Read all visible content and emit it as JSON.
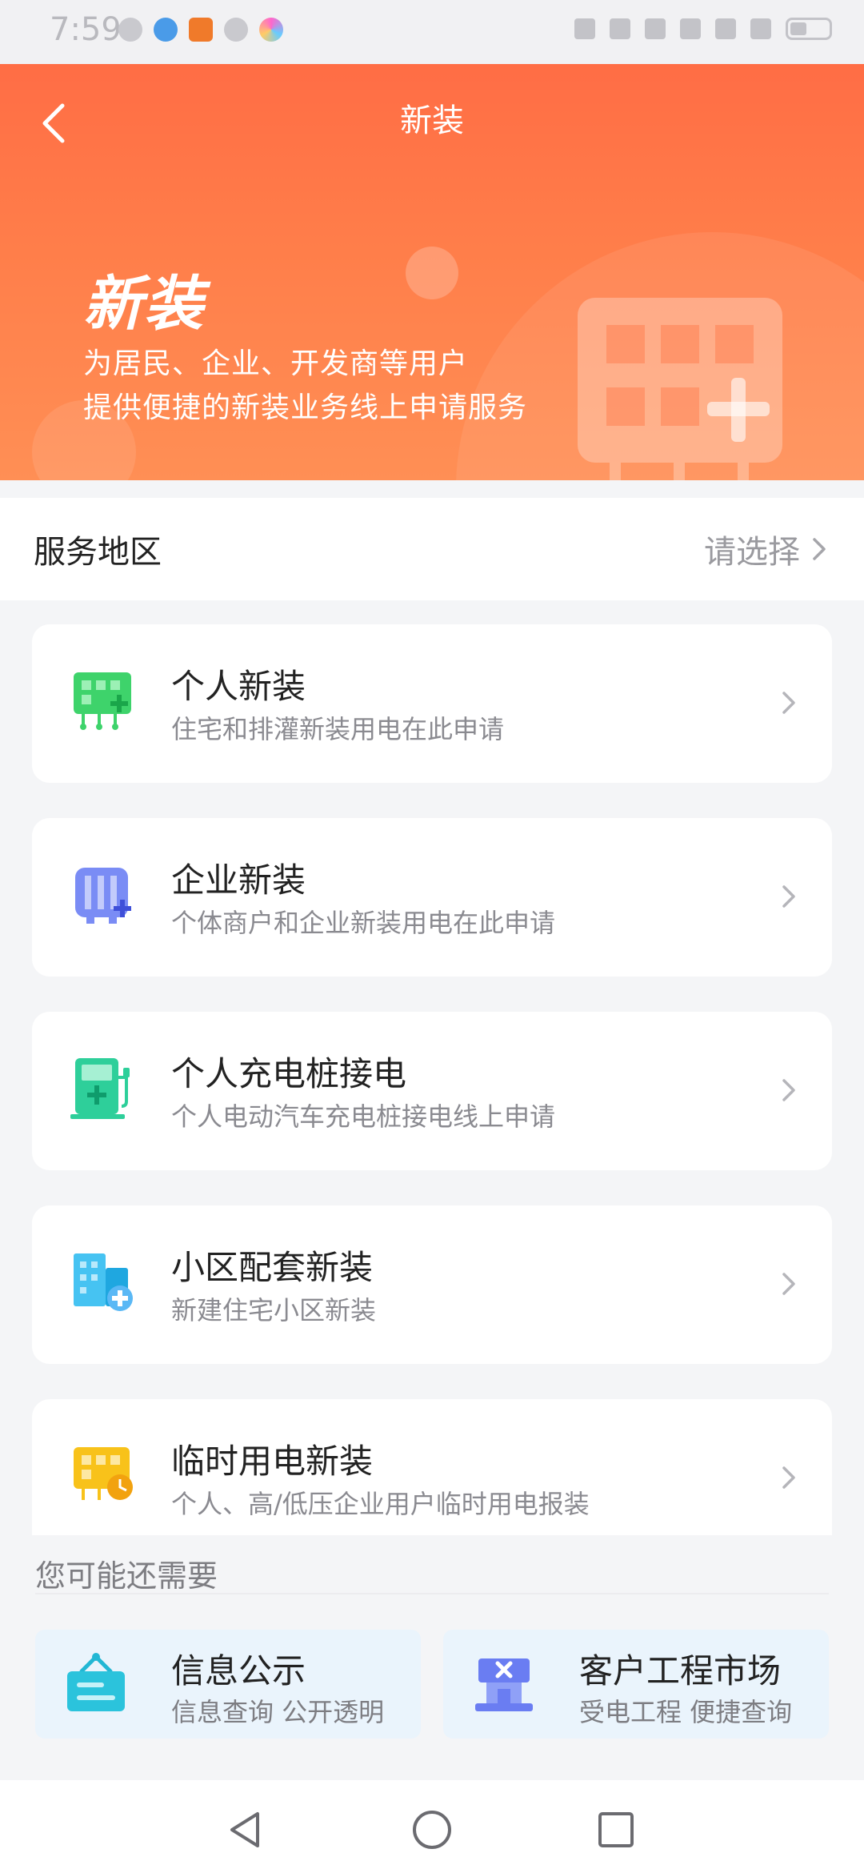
{
  "status_bar": {
    "time": "7:59"
  },
  "header": {
    "nav_title": "新装",
    "hero_title": "新装",
    "hero_subtitle_line1": "为居民、企业、开发商等用户",
    "hero_subtitle_line2": "提供便捷的新装业务线上申请服务"
  },
  "service_region": {
    "label": "服务地区",
    "value": "请选择"
  },
  "cards": [
    {
      "title": "个人新装",
      "subtitle": "住宅和排灌新装用电在此申请",
      "icon": "residential-meter-icon",
      "color": "#3ed36b"
    },
    {
      "title": "企业新装",
      "subtitle": "个体商户和企业新装用电在此申请",
      "icon": "enterprise-meter-icon",
      "color": "#6a7df2"
    },
    {
      "title": "个人充电桩接电",
      "subtitle": "个人电动汽车充电桩接电线上申请",
      "icon": "charging-pile-icon",
      "color": "#2ecf9a"
    },
    {
      "title": "小区配套新装",
      "subtitle": "新建住宅小区新装",
      "icon": "building-icon",
      "color": "#35b9ee"
    },
    {
      "title": "临时用电新装",
      "subtitle": "个人、高/低压企业用户临时用电报装",
      "icon": "temporary-meter-icon",
      "color": "#f8c21a"
    }
  ],
  "more": {
    "section_title": "您可能还需要",
    "tiles": [
      {
        "title": "信息公示",
        "subtitle": "信息查询 公开透明",
        "icon": "notice-board-icon"
      },
      {
        "title": "客户工程市场",
        "subtitle": "受电工程 便捷查询",
        "icon": "engineering-market-icon"
      }
    ]
  },
  "colors": {
    "accent": "#ff7448",
    "background": "#f4f5f7"
  }
}
